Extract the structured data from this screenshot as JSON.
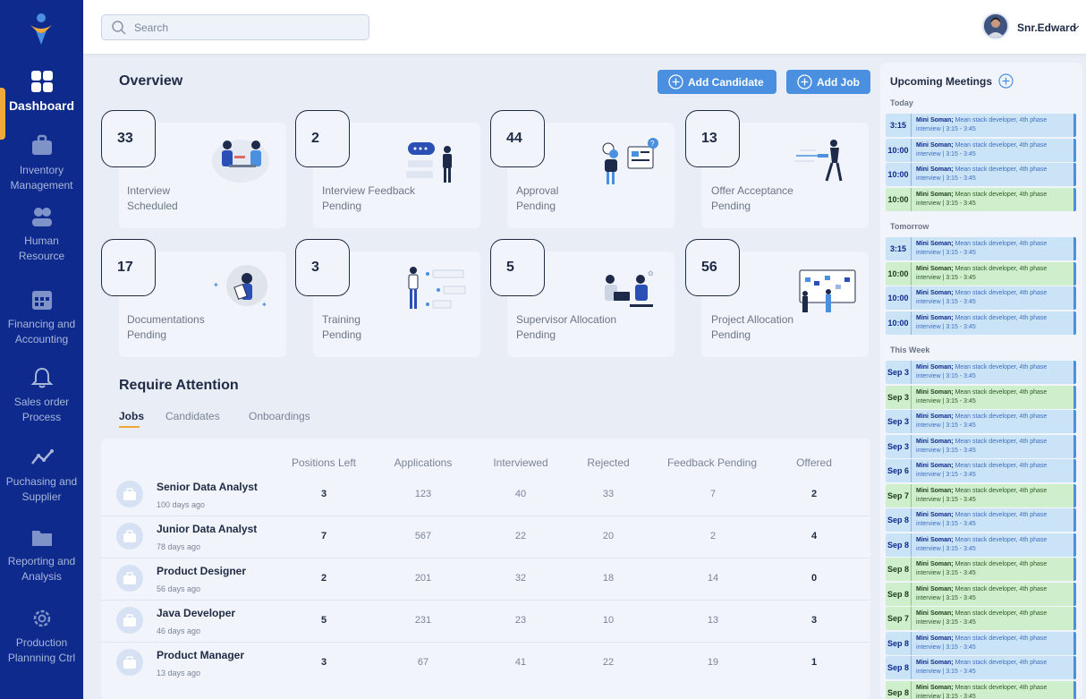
{
  "sidebar": {
    "items": [
      {
        "label": "Dashboard",
        "icon": "dashboard-grid-icon"
      },
      {
        "label": "Inventory Management",
        "icon": "briefcase-icon"
      },
      {
        "label": "Human Resource",
        "icon": "users-icon"
      },
      {
        "label": "Financing and Accounting",
        "icon": "calendar-icon"
      },
      {
        "label": "Sales order Process",
        "icon": "bell-icon"
      },
      {
        "label": "Puchasing and Supplier",
        "icon": "trend-line-icon"
      },
      {
        "label": "Reporting and Analysis",
        "icon": "folder-icon"
      },
      {
        "label": "Production Plannning Ctrl",
        "icon": "gear-icon"
      }
    ]
  },
  "header": {
    "search_placeholder": "Search",
    "user_name": "Snr.Edward"
  },
  "overview": {
    "title": "Overview",
    "add_candidate": "Add Candidate",
    "add_job": "Add Job",
    "cards": [
      {
        "value": "33",
        "line1": "Interview",
        "line2": "Scheduled"
      },
      {
        "value": "2",
        "line1": "Interview  Feedback",
        "line2": "Pending"
      },
      {
        "value": "44",
        "line1": "Approval",
        "line2": "Pending"
      },
      {
        "value": "13",
        "line1": "Offer Acceptance",
        "line2": "Pending"
      },
      {
        "value": "17",
        "line1": "Documentations",
        "line2": "Pending"
      },
      {
        "value": "3",
        "line1": "Training",
        "line2": "Pending"
      },
      {
        "value": "5",
        "line1": "Supervisor Allocation",
        "line2": "Pending"
      },
      {
        "value": "56",
        "line1": "Project Allocation",
        "line2": "Pending"
      }
    ]
  },
  "attention": {
    "title": "Require Attention",
    "tabs": [
      "Jobs",
      "Candidates",
      "Onboardings"
    ],
    "columns": [
      "Positions Left",
      "Applications",
      "Interviewed",
      "Rejected",
      "Feedback Pending",
      "Offered"
    ],
    "rows": [
      {
        "title": "Senior Data Analyst",
        "sub": "100 days ago",
        "values": [
          "3",
          "123",
          "40",
          "33",
          "7",
          "2"
        ]
      },
      {
        "title": "Junior Data Analyst",
        "sub": "78 days ago",
        "values": [
          "7",
          "567",
          "22",
          "20",
          "2",
          "4"
        ]
      },
      {
        "title": "Product Designer",
        "sub": "56 days ago",
        "values": [
          "2",
          "201",
          "32",
          "18",
          "14",
          "0"
        ]
      },
      {
        "title": "Java Developer",
        "sub": "46 days ago",
        "values": [
          "5",
          "231",
          "23",
          "10",
          "13",
          "3"
        ]
      },
      {
        "title": "Product Manager",
        "sub": "13 days ago",
        "values": [
          "3",
          "67",
          "41",
          "22",
          "19",
          "1"
        ]
      }
    ]
  },
  "meetings": {
    "title": "Upcoming Meetings",
    "name": "Mini Soman;",
    "desc": " Mean stack developer, 4th phase",
    "line2": "interview | 3:15 - 3:45",
    "sections": [
      {
        "label": "Today",
        "items": [
          {
            "time": "3:15",
            "color": "blue"
          },
          {
            "time": "10:00",
            "color": "blue"
          },
          {
            "time": "10:00",
            "color": "blue"
          },
          {
            "time": "10:00",
            "color": "green"
          }
        ]
      },
      {
        "label": "Tomorrow",
        "items": [
          {
            "time": "3:15",
            "color": "blue"
          },
          {
            "time": "10:00",
            "color": "green"
          },
          {
            "time": "10:00",
            "color": "blue"
          },
          {
            "time": "10:00",
            "color": "blue"
          }
        ]
      },
      {
        "label": "This Week",
        "items": [
          {
            "time": "Sep 3",
            "color": "blue"
          },
          {
            "time": "Sep 3",
            "color": "green"
          },
          {
            "time": "Sep 3",
            "color": "blue"
          },
          {
            "time": "Sep 3",
            "color": "blue"
          },
          {
            "time": "Sep 6",
            "color": "blue"
          },
          {
            "time": "Sep 7",
            "color": "green"
          },
          {
            "time": "Sep 8",
            "color": "blue"
          },
          {
            "time": "Sep 8",
            "color": "blue"
          },
          {
            "time": "Sep 8",
            "color": "green"
          },
          {
            "time": "Sep 8",
            "color": "green"
          },
          {
            "time": "Sep 7",
            "color": "green"
          },
          {
            "time": "Sep 8",
            "color": "blue"
          },
          {
            "time": "Sep 8",
            "color": "blue"
          },
          {
            "time": "Sep 8",
            "color": "green"
          }
        ]
      }
    ]
  },
  "colors": {
    "sidebar": "#0d2a8c",
    "accent": "#4a8fe0",
    "active_marker": "#f2a93b",
    "meeting_blue": "#cbe3f7",
    "meeting_green": "#cfeecb"
  }
}
